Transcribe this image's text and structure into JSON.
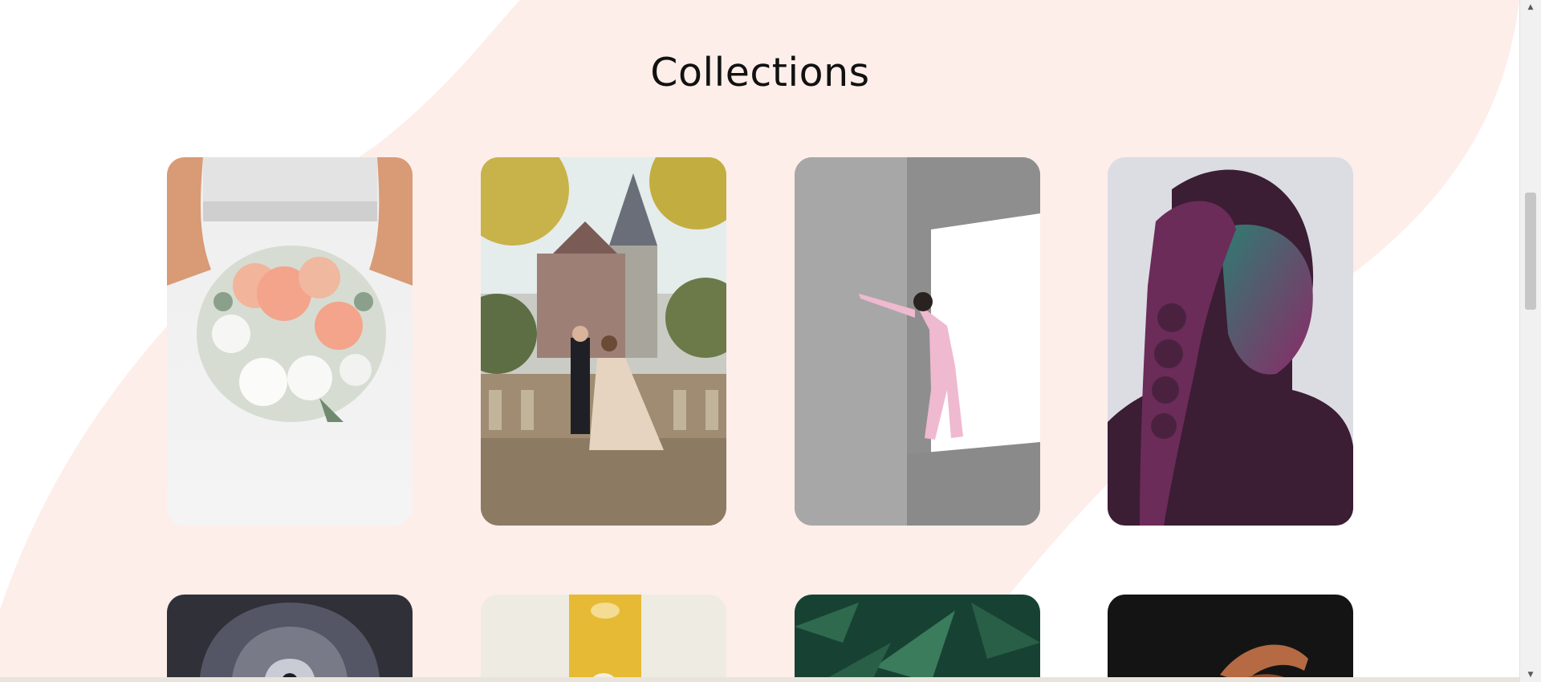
{
  "collections": {
    "title": "Collections",
    "row1": [
      {
        "name": "bridal-bouquet"
      },
      {
        "name": "wedding-couple-castle"
      },
      {
        "name": "woman-pink-suit-concrete"
      },
      {
        "name": "portrait-neon-light"
      }
    ],
    "row2": [
      {
        "name": "arched-corridor"
      },
      {
        "name": "yellow-abstract"
      },
      {
        "name": "green-foliage"
      },
      {
        "name": "hands-dark"
      }
    ]
  },
  "colors": {
    "background": "#ffffff",
    "accent_shape": "#fdeeea",
    "title": "#111111"
  },
  "icons": {
    "scroll_up": "triangle-up",
    "scroll_down": "triangle-down"
  }
}
